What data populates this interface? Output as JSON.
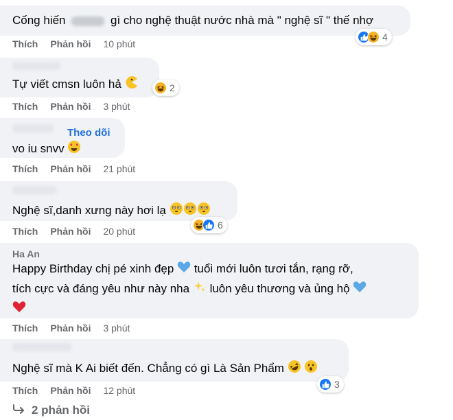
{
  "actions": {
    "like": "Thích",
    "reply": "Phản hồi"
  },
  "comments": [
    {
      "text_before": "Cống hiến",
      "text_after": "gì cho nghệ thuật nước nhà mà \" nghệ sĩ \" thế nhợ",
      "time": "10 phút",
      "reaction_count": "4",
      "reactions": [
        "like-icon",
        "haha-icon"
      ]
    },
    {
      "text": "Tự viết cmsn luôn hả",
      "time": "3 phút",
      "reaction_count": "2",
      "reactions": [
        "haha-icon"
      ]
    },
    {
      "follow": "Theo dõi",
      "text": "vo iu snvv",
      "time": "21 phút"
    },
    {
      "text": "Nghệ sĩ,danh xưng này hơi lạ",
      "time": "20 phút",
      "reaction_count": "6",
      "reactions": [
        "haha-icon",
        "like-icon"
      ]
    },
    {
      "author": "Ha An",
      "line1": "Happy Birthday chị pé xinh đẹp",
      "line1b": "tuổi mới luôn tươi tắn, rạng rỡ,",
      "line2": "tích cực và đáng yêu như này nha",
      "line2b": "luôn yêu thương và ủng hộ",
      "time": "3 phút"
    },
    {
      "text": "Nghệ sĩ mà K Ai biết đến. Chẳng có gì Là Sản Phẩm",
      "time": "12 phút",
      "reaction_count": "3",
      "reactions": [
        "like-icon"
      ]
    }
  ],
  "more_replies": "2 phản hồi",
  "colors": {
    "bubble": "#f0f2f5",
    "link": "#216fdb",
    "muted": "#65676b",
    "like": "#1877f2",
    "haha": "#f7b125"
  }
}
